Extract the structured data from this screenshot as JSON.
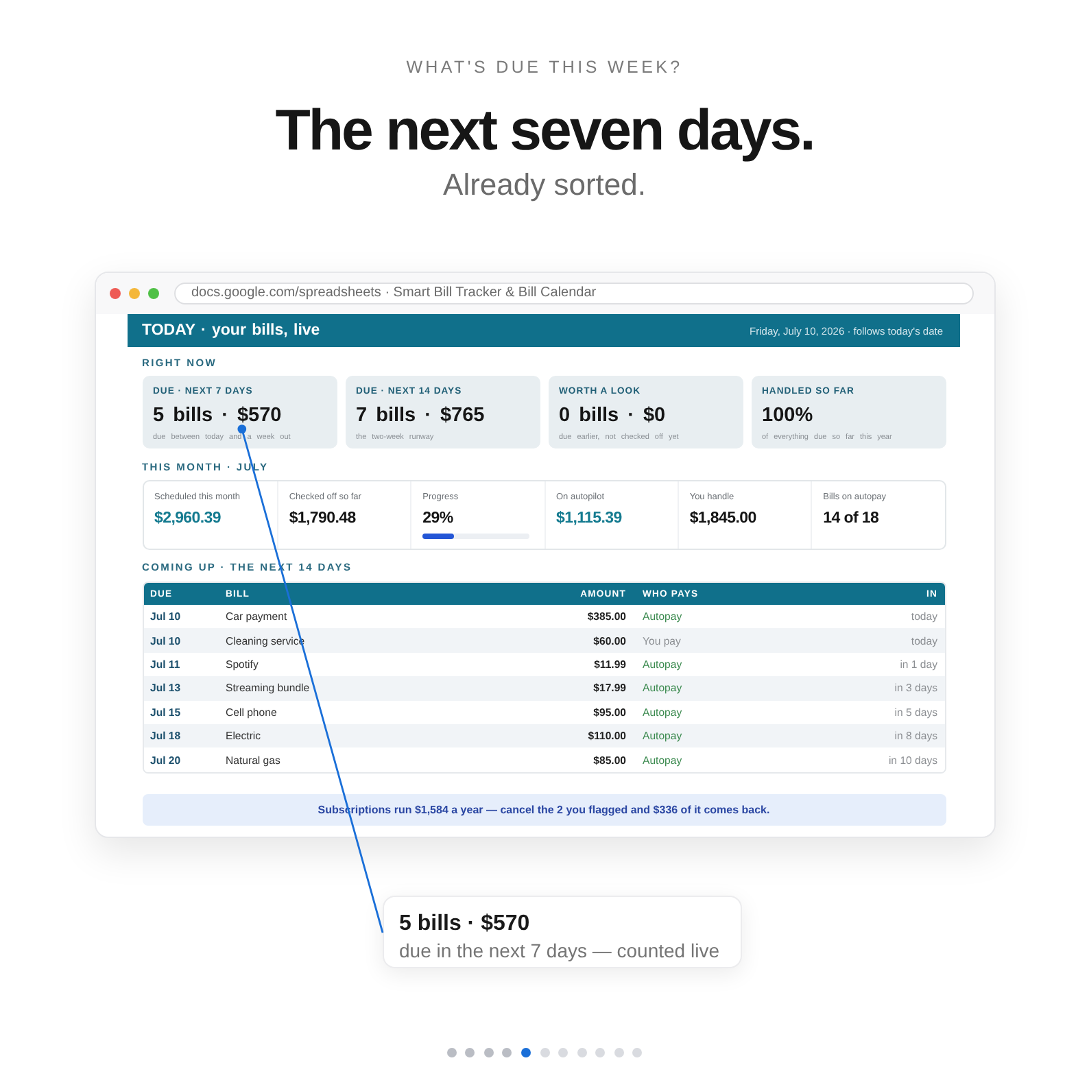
{
  "header": {
    "eyebrow": "WHAT'S DUE THIS WEEK?",
    "title": "The next seven days.",
    "subtitle": "Already sorted."
  },
  "browser": {
    "address": "docs.google.com/spreadsheets · Smart Bill Tracker & Bill Calendar"
  },
  "sheet": {
    "bar": {
      "title": "TODAY · your bills, live",
      "date": "Friday, July 10, 2026 · follows today's date"
    },
    "right_now": {
      "heading": "RIGHT NOW",
      "cards": [
        {
          "label": "DUE · NEXT 7 DAYS",
          "value": "5 bills · $570",
          "note": "due between today and a week out"
        },
        {
          "label": "DUE · NEXT 14 DAYS",
          "value": "7 bills · $765",
          "note": "the two-week runway"
        },
        {
          "label": "WORTH A LOOK",
          "value": "0 bills · $0",
          "note": "due earlier, not checked off yet"
        },
        {
          "label": "HANDLED SO FAR",
          "value": "100%",
          "note": "of everything due so far this year"
        }
      ]
    },
    "this_month": {
      "heading": "THIS MONTH · JULY",
      "stats": [
        {
          "kind": "value",
          "label": "Scheduled this month",
          "value": "$2,960.39",
          "accent": true
        },
        {
          "kind": "value",
          "label": "Checked off so far",
          "value": "$1,790.48",
          "accent": false
        },
        {
          "kind": "progress",
          "label": "Progress",
          "value": "29%",
          "accent": false,
          "level": 0.29
        },
        {
          "kind": "value",
          "label": "On autopilot",
          "value": "$1,115.39",
          "accent": true
        },
        {
          "kind": "value",
          "label": "You handle",
          "value": "$1,845.00",
          "accent": false
        },
        {
          "kind": "value",
          "label": "Bills on autopay",
          "value": "14 of 18",
          "accent": false
        }
      ]
    },
    "coming_up": {
      "heading": "COMING UP · THE NEXT 14 DAYS",
      "columns": [
        "DUE",
        "BILL",
        "AMOUNT",
        "WHO PAYS",
        "IN"
      ],
      "rows": [
        {
          "due": "Jul 10",
          "bill": "Car payment",
          "amount": "$385.00",
          "who_pays": "Autopay",
          "autopay": true,
          "in": "today"
        },
        {
          "due": "Jul 10",
          "bill": "Cleaning service",
          "amount": "$60.00",
          "who_pays": "You pay",
          "autopay": false,
          "in": "today"
        },
        {
          "due": "Jul 11",
          "bill": "Spotify",
          "amount": "$11.99",
          "who_pays": "Autopay",
          "autopay": true,
          "in": "in 1 day"
        },
        {
          "due": "Jul 13",
          "bill": "Streaming bundle",
          "amount": "$17.99",
          "who_pays": "Autopay",
          "autopay": true,
          "in": "in 3 days"
        },
        {
          "due": "Jul 15",
          "bill": "Cell phone",
          "amount": "$95.00",
          "who_pays": "Autopay",
          "autopay": true,
          "in": "in 5 days"
        },
        {
          "due": "Jul 18",
          "bill": "Electric",
          "amount": "$110.00",
          "who_pays": "Autopay",
          "autopay": true,
          "in": "in 8 days"
        },
        {
          "due": "Jul 20",
          "bill": "Natural gas",
          "amount": "$85.00",
          "who_pays": "Autopay",
          "autopay": true,
          "in": "in 10 days"
        }
      ]
    },
    "tip": "Subscriptions run $1,584 a year — cancel the 2 you flagged and $336 of it comes back."
  },
  "callout": {
    "title": "5 bills · $570",
    "subtitle": "due in the next 7 days — counted live"
  },
  "pagination": [
    {
      "selected": false
    },
    {
      "selected": false
    },
    {
      "selected": false
    },
    {
      "selected": false
    },
    {
      "selected": true
    },
    {
      "selected": false
    },
    {
      "selected": false
    },
    {
      "selected": false
    },
    {
      "selected": false
    },
    {
      "selected": false
    },
    {
      "selected": false
    }
  ]
}
